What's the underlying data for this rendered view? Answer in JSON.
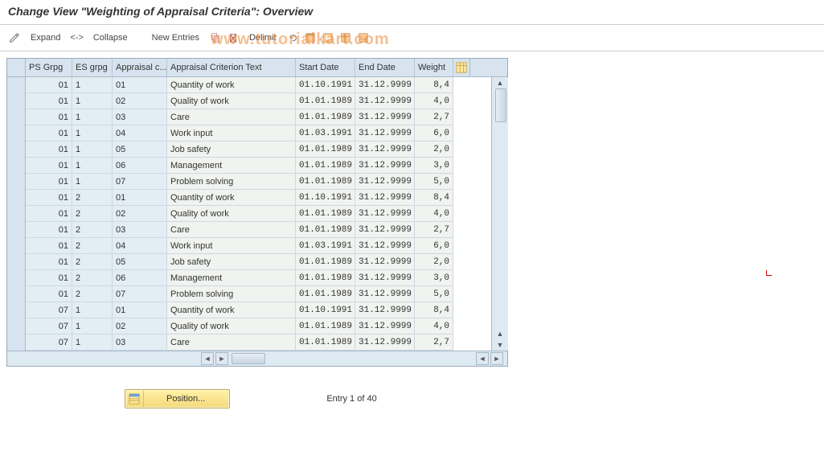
{
  "page_title": "Change View \"Weighting of Appraisal Criteria\": Overview",
  "toolbar": {
    "expand": "Expand",
    "collapse": "Collapse",
    "new_entries": "New Entries",
    "delimit": "Delimit"
  },
  "columns": {
    "ps": "PS Grpg",
    "es": "ES grpg",
    "ac": "Appraisal c...",
    "text": "Appraisal Criterion Text",
    "start": "Start Date",
    "end": "End Date",
    "weight": "Weight"
  },
  "rows": [
    {
      "ps": "01",
      "es": "1",
      "ac": "01",
      "text": "Quantity of work",
      "start": "01.10.1991",
      "end": "31.12.9999",
      "wt": "8,40"
    },
    {
      "ps": "01",
      "es": "1",
      "ac": "02",
      "text": "Quality of work",
      "start": "01.01.1989",
      "end": "31.12.9999",
      "wt": "4,00"
    },
    {
      "ps": "01",
      "es": "1",
      "ac": "03",
      "text": "Care",
      "start": "01.01.1989",
      "end": "31.12.9999",
      "wt": "2,70"
    },
    {
      "ps": "01",
      "es": "1",
      "ac": "04",
      "text": "Work input",
      "start": "01.03.1991",
      "end": "31.12.9999",
      "wt": "6,00"
    },
    {
      "ps": "01",
      "es": "1",
      "ac": "05",
      "text": "Job safety",
      "start": "01.01.1989",
      "end": "31.12.9999",
      "wt": "2,00"
    },
    {
      "ps": "01",
      "es": "1",
      "ac": "06",
      "text": "Management",
      "start": "01.01.1989",
      "end": "31.12.9999",
      "wt": "3,00"
    },
    {
      "ps": "01",
      "es": "1",
      "ac": "07",
      "text": "Problem solving",
      "start": "01.01.1989",
      "end": "31.12.9999",
      "wt": "5,00"
    },
    {
      "ps": "01",
      "es": "2",
      "ac": "01",
      "text": "Quantity of work",
      "start": "01.10.1991",
      "end": "31.12.9999",
      "wt": "8,40"
    },
    {
      "ps": "01",
      "es": "2",
      "ac": "02",
      "text": "Quality of work",
      "start": "01.01.1989",
      "end": "31.12.9999",
      "wt": "4,00"
    },
    {
      "ps": "01",
      "es": "2",
      "ac": "03",
      "text": "Care",
      "start": "01.01.1989",
      "end": "31.12.9999",
      "wt": "2,70"
    },
    {
      "ps": "01",
      "es": "2",
      "ac": "04",
      "text": "Work input",
      "start": "01.03.1991",
      "end": "31.12.9999",
      "wt": "6,00"
    },
    {
      "ps": "01",
      "es": "2",
      "ac": "05",
      "text": "Job safety",
      "start": "01.01.1989",
      "end": "31.12.9999",
      "wt": "2,00"
    },
    {
      "ps": "01",
      "es": "2",
      "ac": "06",
      "text": "Management",
      "start": "01.01.1989",
      "end": "31.12.9999",
      "wt": "3,00"
    },
    {
      "ps": "01",
      "es": "2",
      "ac": "07",
      "text": "Problem solving",
      "start": "01.01.1989",
      "end": "31.12.9999",
      "wt": "5,00"
    },
    {
      "ps": "07",
      "es": "1",
      "ac": "01",
      "text": "Quantity of work",
      "start": "01.10.1991",
      "end": "31.12.9999",
      "wt": "8,40"
    },
    {
      "ps": "07",
      "es": "1",
      "ac": "02",
      "text": "Quality of work",
      "start": "01.01.1989",
      "end": "31.12.9999",
      "wt": "4,00"
    },
    {
      "ps": "07",
      "es": "1",
      "ac": "03",
      "text": "Care",
      "start": "01.01.1989",
      "end": "31.12.9999",
      "wt": "2,70"
    }
  ],
  "footer": {
    "position": "Position...",
    "entry": "Entry 1 of 40"
  },
  "watermark": "www.tutorialkart.com"
}
